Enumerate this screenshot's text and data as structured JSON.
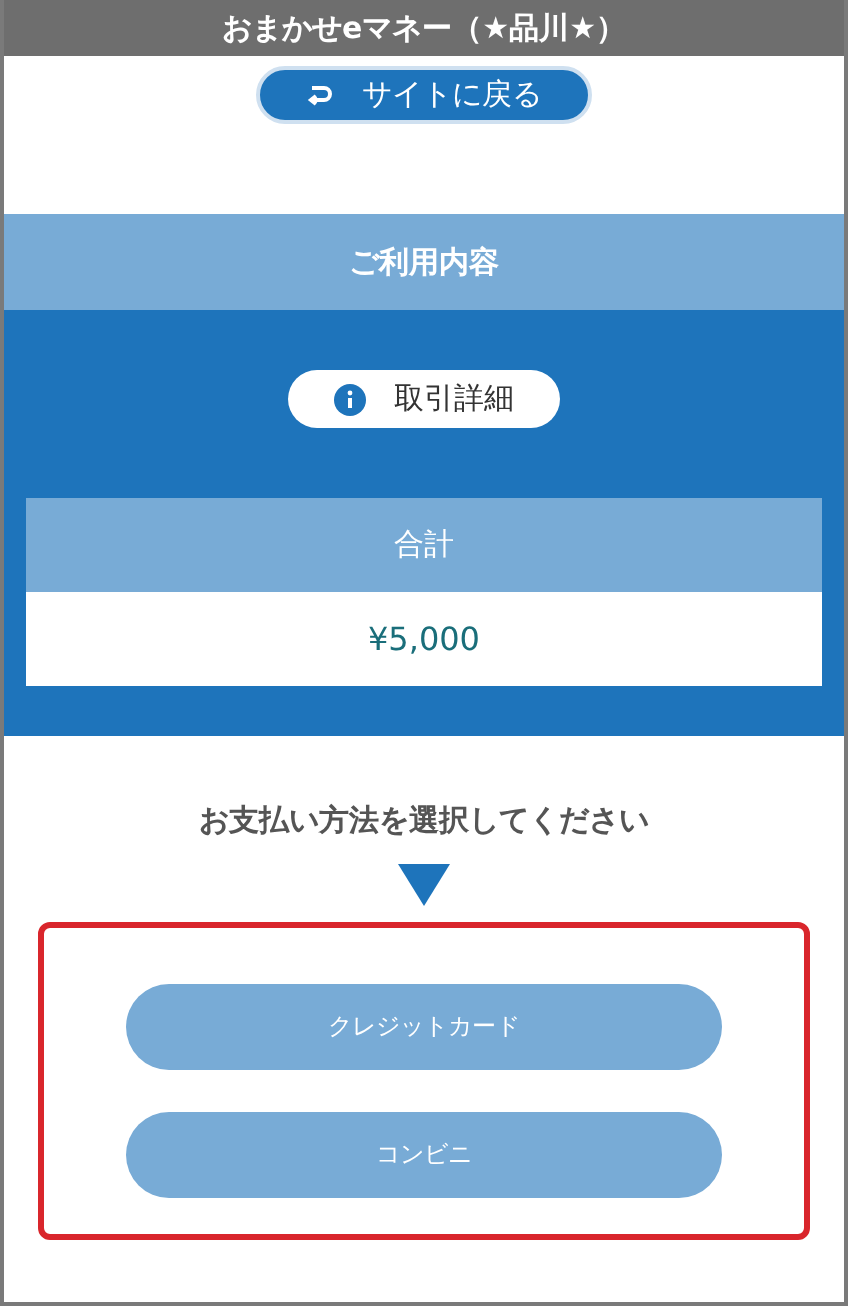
{
  "header": {
    "title": "おまかせeマネー（★品川★）"
  },
  "back_button": {
    "label": "サイトに戻る"
  },
  "section": {
    "title": "ご利用内容",
    "details_button": {
      "label": "取引詳細"
    },
    "total": {
      "label": "合計",
      "value": "¥5,000"
    }
  },
  "prompt": "お支払い方法を選択してください",
  "payment_methods": [
    {
      "label": "クレジットカード"
    },
    {
      "label": "コンビニ"
    }
  ]
}
